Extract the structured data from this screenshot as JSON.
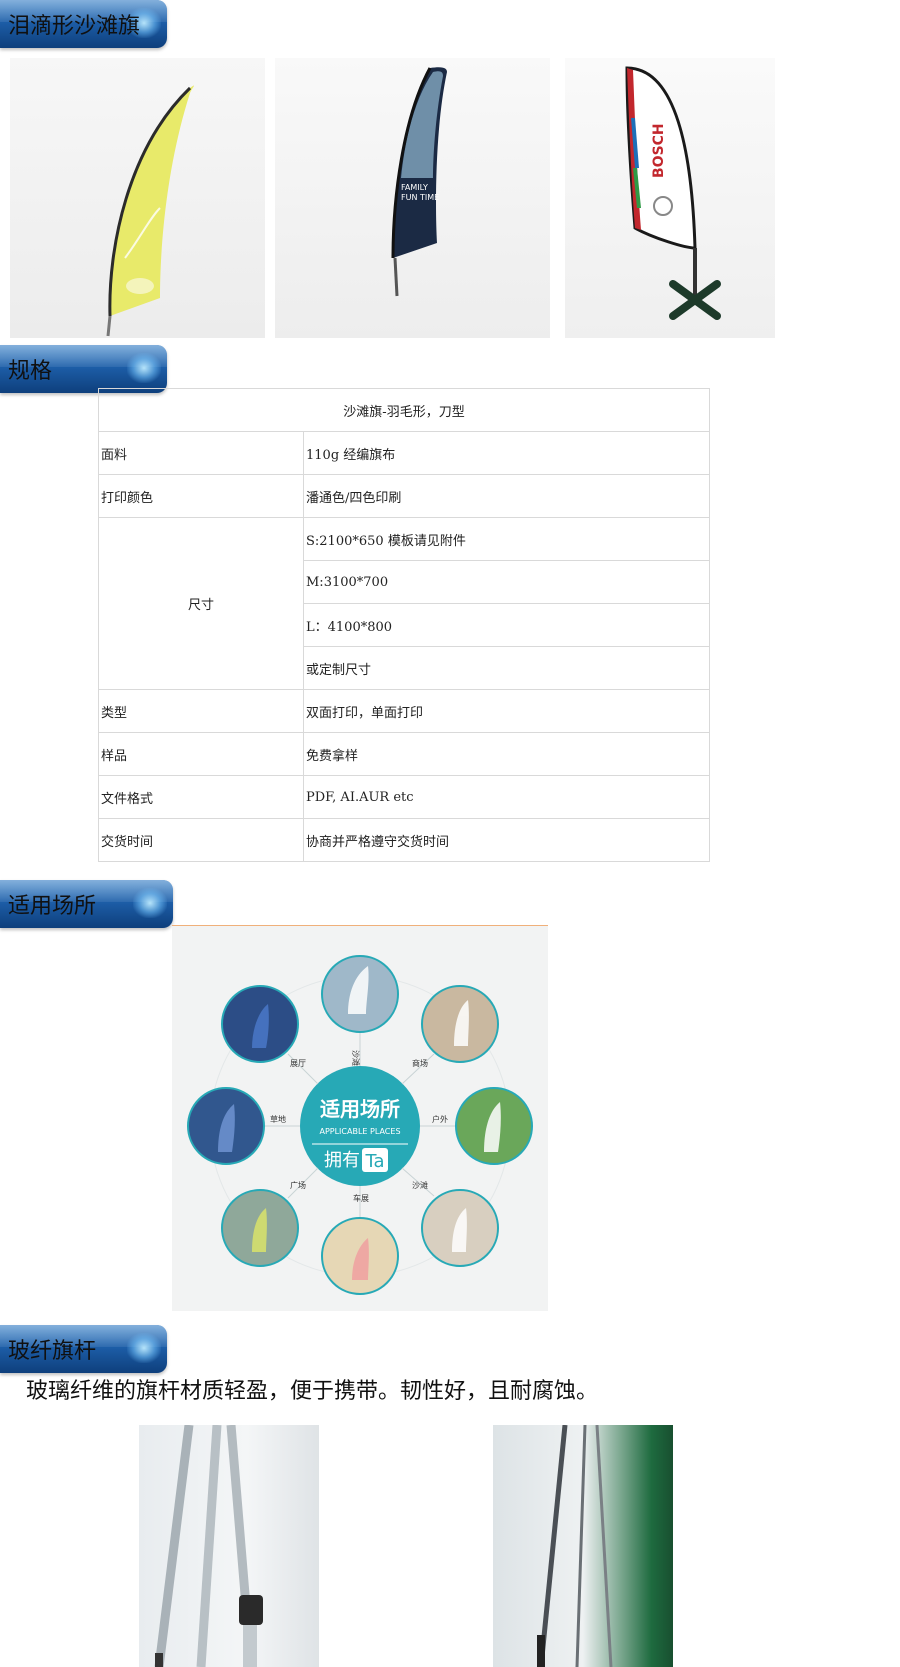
{
  "sections": {
    "teardrop": "泪滴形沙滩旗",
    "spec": "规格",
    "places": "适用场所",
    "pole": "玻纤旗杆"
  },
  "flags": {
    "f2_text_line1": "FAMILY",
    "f2_text_line2": "FUN TIME",
    "f3_brand": "BOSCH"
  },
  "spec_table": {
    "title": "沙滩旗-羽毛形，刀型",
    "rows": {
      "fabric_label": "面料",
      "fabric_value": "110g 经编旗布",
      "print_label": "打印颜色",
      "print_value": "潘通色/四色印刷",
      "size_label": "尺寸",
      "size_s": "S:2100*650 模板请见附件",
      "size_m": "M:3100*700",
      "size_l": "L：4100*800",
      "size_custom": "或定制尺寸",
      "type_label": "类型",
      "type_value": "双面打印，单面打印",
      "sample_label": "样品",
      "sample_value": "免费拿样",
      "format_label": "文件格式",
      "format_value": "PDF, AI.AUR etc",
      "delivery_label": "交货时间",
      "delivery_value": "协商并严格遵守交货时间"
    }
  },
  "places_graphic": {
    "center_title": "适用场所",
    "center_subtitle": "APPLICABLE PLACES",
    "center_slogan": "拥有",
    "center_brand": "Ta",
    "labels": [
      "沙滩",
      "商场",
      "户外",
      "沙滩",
      "车展",
      "广场",
      "草地",
      "展厅"
    ]
  },
  "pole_text": "玻璃纤维的旗杆材质轻盈，便于携带。韧性好，且耐腐蚀。",
  "colors": {
    "tab_blue": "#1d5ea8",
    "teal": "#27a9b6"
  }
}
